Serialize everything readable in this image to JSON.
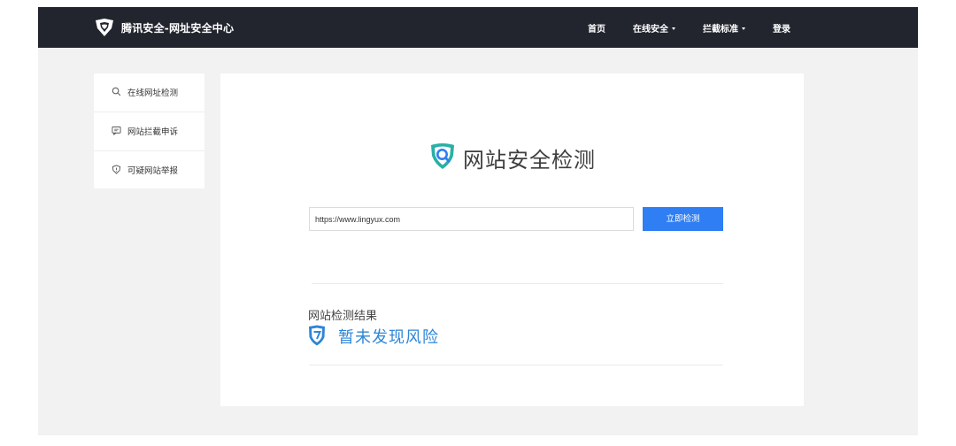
{
  "header": {
    "brand": "腾讯安全-网址安全中心",
    "nav": [
      {
        "label": "首页",
        "has_dropdown": false
      },
      {
        "label": "在线安全",
        "has_dropdown": true
      },
      {
        "label": "拦截标准",
        "has_dropdown": true
      },
      {
        "label": "登录",
        "has_dropdown": false
      }
    ]
  },
  "sidebar": {
    "items": [
      {
        "label": "在线网址检测",
        "icon": "search-icon"
      },
      {
        "label": "网站拦截申诉",
        "icon": "message-icon"
      },
      {
        "label": "可疑网站举报",
        "icon": "shield-icon"
      }
    ]
  },
  "main": {
    "title": "网站安全检测",
    "url_input": {
      "value": "https://www.lingyux.com"
    },
    "check_button": "立即检测",
    "result_label": "网站检测结果",
    "result_status": "暂未发现风险"
  },
  "colors": {
    "header_bg": "#22252e",
    "accent": "#2f7ef3",
    "status": "#2f86d6",
    "logo_accent": "#2ab0a6"
  }
}
